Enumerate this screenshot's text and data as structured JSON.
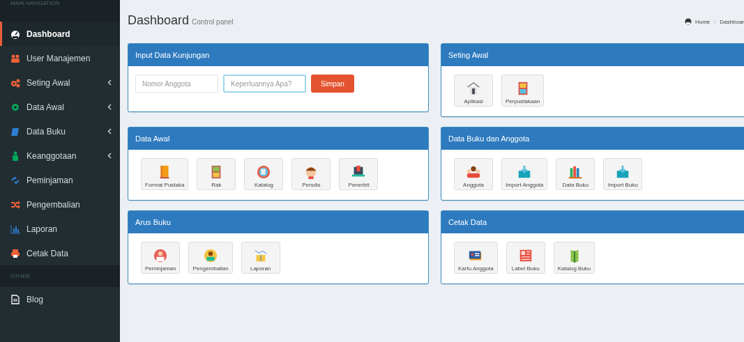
{
  "sidebar": {
    "sections": [
      {
        "header": "MAIN NAVIGATION",
        "items": [
          {
            "label": "Dashboard",
            "selected": true,
            "expandable": false
          },
          {
            "label": "User Manajemen",
            "selected": false,
            "expandable": false
          },
          {
            "label": "Seting Awal",
            "selected": false,
            "expandable": true
          },
          {
            "label": "Data Awal",
            "selected": false,
            "expandable": true
          },
          {
            "label": "Data Buku",
            "selected": false,
            "expandable": true
          },
          {
            "label": "Keanggotaan",
            "selected": false,
            "expandable": true
          },
          {
            "label": "Peminjaman",
            "selected": false,
            "expandable": false
          },
          {
            "label": "Pengembalian",
            "selected": false,
            "expandable": false
          },
          {
            "label": "Laporan",
            "selected": false,
            "expandable": false
          },
          {
            "label": "Cetak Data",
            "selected": false,
            "expandable": false
          }
        ]
      },
      {
        "header": "OTHER",
        "items": [
          {
            "label": "Blog",
            "selected": false,
            "expandable": false
          }
        ]
      }
    ]
  },
  "page_header": {
    "title": "Dashboard",
    "subtitle": "Control panel"
  },
  "breadcrumb": [
    "Home",
    "Dashboar"
  ],
  "panels": [
    {
      "title": "Input Data Kunjungan",
      "kind": "form",
      "fields": [
        {
          "placeholder": "Nomor Anggota",
          "focused": false
        },
        {
          "placeholder": "Keperluannya Apa?",
          "focused": true
        }
      ],
      "button": "Simpan"
    },
    {
      "title": "Seting Awal",
      "kind": "tiles",
      "tiles": [
        "Aplikasi",
        "Perpustakaan"
      ]
    },
    {
      "title": "Data Awal",
      "kind": "tiles",
      "tiles": [
        "Format Pustaka",
        "Rak",
        "Katalog",
        "Penulis",
        "Penerbit"
      ]
    },
    {
      "title": "Data Buku dan Anggota",
      "kind": "tiles",
      "tiles": [
        "Anggota",
        "Import Anggota",
        "Data Buku",
        "Import Buku"
      ]
    },
    {
      "title": "Arus Buku",
      "kind": "tiles",
      "tiles": [
        "Peminjaman",
        "Pengembalian",
        "Laporan"
      ]
    },
    {
      "title": "Cetak Data",
      "kind": "tiles",
      "tiles": [
        "Kartu Anggota",
        "Label Buku",
        "Katalog Buku"
      ]
    }
  ]
}
